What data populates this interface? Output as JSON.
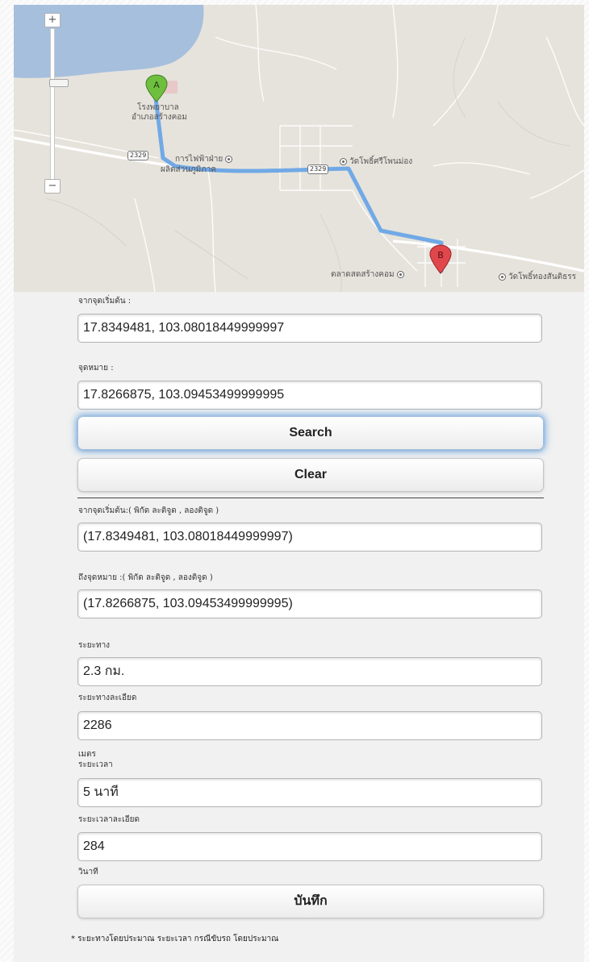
{
  "map": {
    "zoom_in": "+",
    "zoom_out": "−",
    "marker_a": "A",
    "marker_b": "B",
    "labels": {
      "hospital_line1": "โรงพยาบาล",
      "hospital_line2": "อำเภอสร้างคอม",
      "electricity_line1": "การไฟฟ้าฝ่าย",
      "electricity_line2": "ผลิตส่วนภูมิภาค",
      "temple_1": "วัดโพธิ์ศรีโพนม่อง",
      "market": "ตลาดสดสร้างคอม",
      "temple_2": "วัดโพธิ์ทองสันติธรร"
    },
    "route_shields": [
      "2329",
      "2329"
    ]
  },
  "form": {
    "origin_label": "จากจุดเริ่มต้น :",
    "origin_value": "17.8349481, 103.08018449999997",
    "dest_label": "จุดหมาย :",
    "dest_value": "17.8266875, 103.09453499999995",
    "search_button": "Search",
    "clear_button": "Clear"
  },
  "results": {
    "origin_coord_label": "จากจุดเริ่มต้น:( พิกัด ละติจูด , ลองติจูด )",
    "origin_coord_value": "(17.8349481, 103.08018449999997)",
    "dest_coord_label": "ถึงจุดหมาย :( พิกัด ละติจูด , ลองติจูด )",
    "dest_coord_value": "(17.8266875, 103.09453499999995)",
    "distance_label": "ระยะทาง",
    "distance_value": "2.3 กม.",
    "distance_detail_label": "ระยะทางละเอียด",
    "distance_detail_value": "2286",
    "distance_unit": "เมตร",
    "duration_label": "ระยะเวลา",
    "duration_value": "5 นาที",
    "duration_detail_label": "ระยะเวลาละเอียด",
    "duration_detail_value": "284",
    "duration_unit": "วินาที",
    "save_button": "บันทึก",
    "footnote": "* ระยะทางโดยประมาณ ระยะเวลา กรณีขับรถ โดยประมาณ"
  },
  "colors": {
    "route": "#6aa5e6",
    "water": "#a5bfdd",
    "marker_a": "#6fbf3f",
    "marker_b": "#e0474c"
  }
}
